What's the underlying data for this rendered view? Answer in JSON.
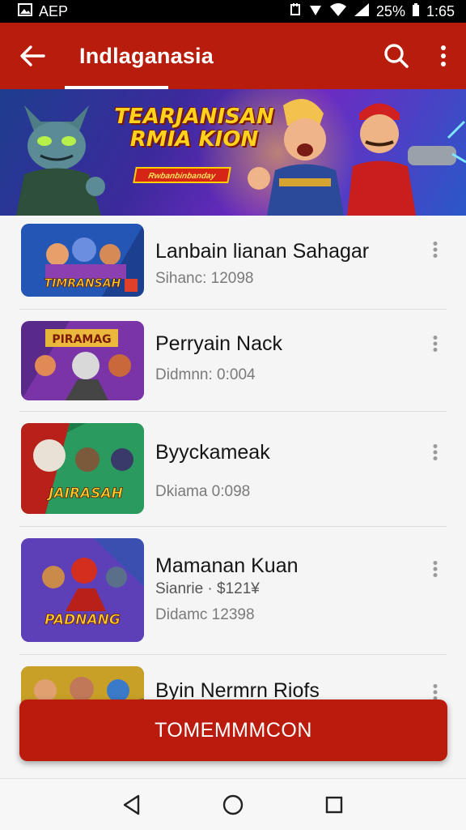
{
  "status_bar": {
    "app_label": "AEP",
    "battery_percent": "25%",
    "time": "1:65"
  },
  "app_bar": {
    "title": "Indlaganasia",
    "back_icon": "arrow-left-icon",
    "search_icon": "search-icon",
    "menu_icon": "more-vert-icon"
  },
  "banner": {
    "title_line1": "TEARJANISAN",
    "title_line2": "RMIA KION",
    "ribbon_text": "Rwbanbinbanday"
  },
  "thumb_texts": [
    "TIMRANSAH",
    "PIRAMAG",
    "JAIRASAH",
    "PADNANG"
  ],
  "items": [
    {
      "title": "Lanbain lianan Sahagar",
      "subtitle": "Sihanc: 12098"
    },
    {
      "title": "Perryain Nack",
      "subtitle": "Didmnn: 0:004"
    },
    {
      "title": "Byyckameak",
      "subtitle": "Dkiama 0:098"
    },
    {
      "title": "Mamanan Kuan",
      "subtitle": "Sianrie · $121¥",
      "subtitle2": "Didamc 12398"
    },
    {
      "title": "Byin Nermrn Riofs",
      "subtitle": ""
    }
  ],
  "cta": {
    "label": "TOMEMMMCON"
  },
  "colors": {
    "primary": "#b71c0c",
    "button": "#bb1b0d"
  }
}
